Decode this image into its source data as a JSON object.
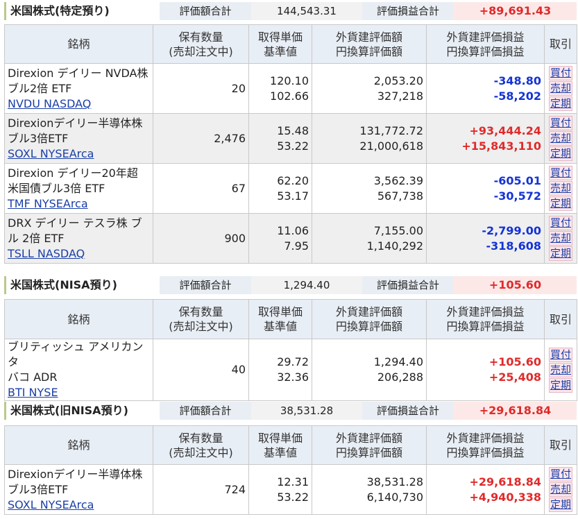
{
  "sections": [
    {
      "title": "米国株式(特定預り)",
      "eval_label": "評価額合計",
      "eval_value": "144,543.31",
      "gain_label": "評価損益合計",
      "gain_value": "+89,691.43",
      "headers": {
        "name": "銘柄",
        "qty": [
          "保有数量",
          "(売却注文中)"
        ],
        "cost": [
          "取得単価",
          "基準値"
        ],
        "value": [
          "外貨建評価額",
          "円換算評価額"
        ],
        "pl": [
          "外貨建評価損益",
          "円換算評価損益"
        ],
        "action": "取引"
      },
      "rows": [
        {
          "name": [
            "Direxion デイリー NVDA株",
            "ブル2倍 ETF"
          ],
          "symbol": "NVDU NASDAQ",
          "qty": "20",
          "cost": "120.10",
          "base": "102.66",
          "value_fx": "2,053.20",
          "value_jpy": "327,218",
          "pl_fx": "-348.80",
          "pl_jpy": "-58,202",
          "sign": "neg"
        },
        {
          "name": [
            "Direxionデイリー半導体株",
            "ブル3倍ETF"
          ],
          "symbol": "SOXL NYSEArca",
          "qty": "2,476",
          "cost": "15.48",
          "base": "53.22",
          "value_fx": "131,772.72",
          "value_jpy": "21,000,618",
          "pl_fx": "+93,444.24",
          "pl_jpy": "+15,843,110",
          "sign": "pos"
        },
        {
          "name": [
            "Direxion デイリー20年超",
            "米国債ブル3倍 ETF"
          ],
          "symbol": "TMF NYSEArca",
          "qty": "67",
          "cost": "62.20",
          "base": "53.17",
          "value_fx": "3,562.39",
          "value_jpy": "567,738",
          "pl_fx": "-605.01",
          "pl_jpy": "-30,572",
          "sign": "neg"
        },
        {
          "name": [
            "DRX デイリー テスラ株 ブ",
            "ル 2倍 ETF"
          ],
          "symbol": "TSLL NASDAQ",
          "qty": "900",
          "cost": "11.06",
          "base": "7.95",
          "value_fx": "7,155.00",
          "value_jpy": "1,140,292",
          "pl_fx": "-2,799.00",
          "pl_jpy": "-318,608",
          "sign": "neg"
        }
      ]
    },
    {
      "title": "米国株式(NISA預り)",
      "eval_label": "評価額合計",
      "eval_value": "1,294.40",
      "gain_label": "評価損益合計",
      "gain_value": "+105.60",
      "rows": [
        {
          "name": [
            "ブリティッシュ アメリカン タ",
            "バコ ADR"
          ],
          "symbol": "BTI NYSE",
          "qty": "40",
          "cost": "29.72",
          "base": "32.36",
          "value_fx": "1,294.40",
          "value_jpy": "206,288",
          "pl_fx": "+105.60",
          "pl_jpy": "+25,408",
          "sign": "pos"
        }
      ]
    },
    {
      "title": "米国株式(旧NISA預り)",
      "eval_label": "評価額合計",
      "eval_value": "38,531.28",
      "gain_label": "評価損益合計",
      "gain_value": "+29,618.84",
      "rows": [
        {
          "name": [
            "Direxionデイリー半導体株",
            "ブル3倍ETF"
          ],
          "symbol": "SOXL NYSEArca",
          "qty": "724",
          "cost": "12.31",
          "base": "53.22",
          "value_fx": "38,531.28",
          "value_jpy": "6,140,730",
          "pl_fx": "+29,618.84",
          "pl_jpy": "+4,940,338",
          "sign": "pos"
        }
      ]
    }
  ],
  "actions": {
    "buy": "買付",
    "sell": "売却",
    "recurring": "定期"
  },
  "colors": {
    "negative": "#1433d6",
    "positive": "#e02a2a",
    "header_bg": "#e8eef5",
    "action_bg": "#fde6ec"
  }
}
